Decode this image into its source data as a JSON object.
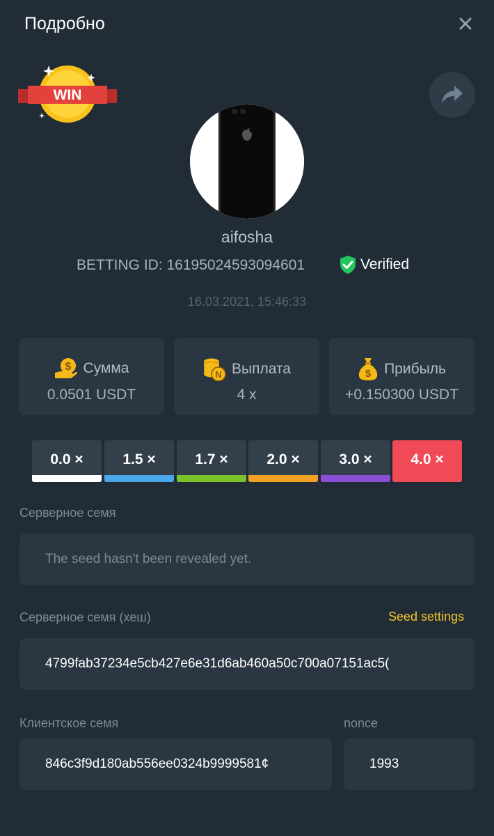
{
  "header": {
    "title": "Подробно",
    "close_icon": "close-icon"
  },
  "badge": {
    "text": "WIN"
  },
  "profile": {
    "username": "aifosha",
    "betting_id": "BETTING ID: 16195024593094601",
    "verified_label": "Verified",
    "verified_color": "#22c55e",
    "datetime": "16.03.2021, 15:46:33"
  },
  "stats": [
    {
      "icon": "money-hand-icon",
      "label": "Сумма",
      "value": "0.0501 USDT"
    },
    {
      "icon": "coins-stack-icon",
      "label": "Выплата",
      "value": "4 x"
    },
    {
      "icon": "money-bag-icon",
      "label": "Прибыль",
      "value": "+0.150300 USDT"
    }
  ],
  "multipliers": [
    {
      "label": "0.0 ×",
      "color": "#ffffff",
      "active": false
    },
    {
      "label": "1.5 ×",
      "color": "#4aa8ea",
      "active": false
    },
    {
      "label": "1.7 ×",
      "color": "#7ac229",
      "active": false
    },
    {
      "label": "2.0 ×",
      "color": "#f2a024",
      "active": false
    },
    {
      "label": "3.0 ×",
      "color": "#8b4fd6",
      "active": false
    },
    {
      "label": "4.0 ×",
      "color": "#ef4a55",
      "active": true
    }
  ],
  "server_seed": {
    "label": "Серверное семя",
    "value": "The seed hasn't been revealed yet."
  },
  "server_seed_hash": {
    "label": "Серверное семя (хеш)",
    "link": "Seed settings",
    "value": "4799fab37234e5cb427e6e31d6ab460a50c700a07151ac5("
  },
  "client_seed": {
    "label": "Клиентское семя",
    "value": "846c3f9d180ab556ee0324b9999581¢"
  },
  "nonce": {
    "label": "nonce",
    "value": "1993"
  }
}
